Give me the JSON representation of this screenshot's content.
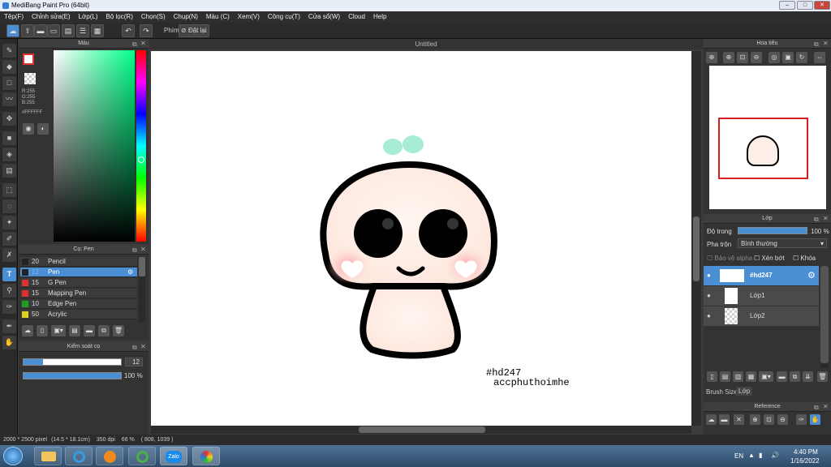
{
  "window": {
    "title": "MediBang Paint Pro (64bit)",
    "min": "–",
    "max": "□",
    "close": "✕"
  },
  "menu": [
    "Tệp(F)",
    "Chỉnh sửa(E)",
    "Lớp(L)",
    "Bộ lọc(R)",
    "Chọn(S)",
    "Chụp(N)",
    "Màu (C)",
    "Xem(V)",
    "Công cụ(T)",
    "Cửa sổ(W)",
    "Cloud",
    "Help"
  ],
  "toolbar": {
    "shortcut_label": "Phím",
    "reset_label": "Đặt lại"
  },
  "color_panel": {
    "title": "Màu",
    "r": "R:255",
    "g": "G:255",
    "b": "B:255",
    "hex": "#FFFFFF"
  },
  "brush_panel": {
    "title": "Cọ: Pen",
    "items": [
      {
        "size": "20",
        "name": "Pencil",
        "color": "#222222"
      },
      {
        "size": "12",
        "name": "Pen",
        "color": "#222222"
      },
      {
        "size": "15",
        "name": "G Pen",
        "color": "#e03030"
      },
      {
        "size": "15",
        "name": "Mapping Pen",
        "color": "#e03030"
      },
      {
        "size": "10",
        "name": "Edge Pen",
        "color": "#20a020"
      },
      {
        "size": "50",
        "name": "Acrylic",
        "color": "#e0d020"
      }
    ]
  },
  "brush_control": {
    "title": "Kiểm soát cọ",
    "size_value": "12",
    "opacity_value": "100 %",
    "size_fraction": 0.2,
    "opacity_fraction": 1.0
  },
  "document": {
    "tab_title": "Untitled",
    "watermark_1": "#hd247",
    "watermark_2": "accphuthoimhe"
  },
  "navigator": {
    "title": "Hoa tiêu"
  },
  "layers": {
    "title": "Lớp",
    "opacity_label": "Độ trong",
    "opacity_value": "100 %",
    "blend_label": "Pha trộn",
    "blend_value": "Bình thường",
    "protect_alpha": "Bảo vệ alpha",
    "clipping": "Xén bớt",
    "lock": "Khóa",
    "items": [
      {
        "name": "#hd247",
        "selected": true
      },
      {
        "name": "Lớp1",
        "selected": false
      },
      {
        "name": "Lớp2",
        "selected": false
      }
    ],
    "tab_brush_size": "Brush Size",
    "tab_layer": "Lớp"
  },
  "reference": {
    "title": "Reference"
  },
  "status": {
    "dimensions": "2000 * 2500 pixel",
    "physical": "(14.5 * 18.1cm)",
    "dpi": "350 dpi",
    "zoom": "66 %",
    "coords": "( 808, 1039 )"
  },
  "taskbar": {
    "lang": "EN",
    "time": "4:40 PM",
    "date": "1/16/2022",
    "zalo": "Zalo"
  }
}
